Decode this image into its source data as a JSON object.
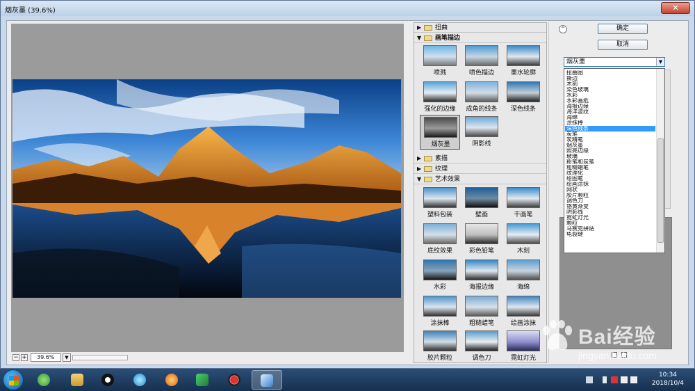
{
  "window": {
    "title": "烟灰墨 (39.6%)",
    "close_glyph": "✕"
  },
  "preview": {
    "zoom_minus": "−",
    "zoom_plus": "+",
    "zoom_value": "39.6%"
  },
  "gallery": {
    "categories": [
      {
        "label": "扭曲",
        "expanded": false
      },
      {
        "label": "画笔描边",
        "expanded": true
      },
      {
        "label": "素描",
        "expanded": false
      },
      {
        "label": "纹理",
        "expanded": false
      },
      {
        "label": "艺术效果",
        "expanded": true
      }
    ],
    "brush_strokes": [
      "喷溅",
      "喷色描边",
      "墨水轮廓",
      "强化的边缘",
      "成角的线条",
      "深色线条",
      "烟灰墨",
      "阴影线"
    ],
    "artistic": [
      "塑料包装",
      "壁画",
      "干画笔",
      "底纹效果",
      "彩色铅笔",
      "木刻",
      "水彩",
      "海报边缘",
      "海绵",
      "涂抹棒",
      "粗糙蜡笔",
      "绘画涂抹",
      "胶片颗粒",
      "调色刀",
      "霓虹灯光"
    ],
    "selected": "烟灰墨"
  },
  "right_panel": {
    "collapse_glyph": "⌃",
    "ok_label": "确定",
    "cancel_label": "取消",
    "filter_select_value": "烟灰墨",
    "dropdown_options": [
      "扭曲图",
      "撕边",
      "木刻",
      "染色玻璃",
      "水彩",
      "水彩画纸",
      "海报边缘",
      "海洋波纹",
      "海绵",
      "涂抹棒",
      "深色线条",
      "炭笔",
      "炭精笔",
      "烟灰墨",
      "照亮边缘",
      "玻璃",
      "粉笔和炭笔",
      "粗糙蜡笔",
      "纹理化",
      "绘图笔",
      "绘画涂抹",
      "网状",
      "胶片颗粒",
      "调色刀",
      "铬黄渐变",
      "阴影线",
      "霓虹灯光",
      "颗粒",
      "马赛克拼贴",
      "龟裂缝"
    ],
    "highlighted_option": "深色线条"
  },
  "taskbar": {
    "time": "10:34",
    "date": "2018/10/4"
  },
  "watermark": {
    "brand": "Bai经验",
    "url": "jingyan.baidu.com"
  }
}
